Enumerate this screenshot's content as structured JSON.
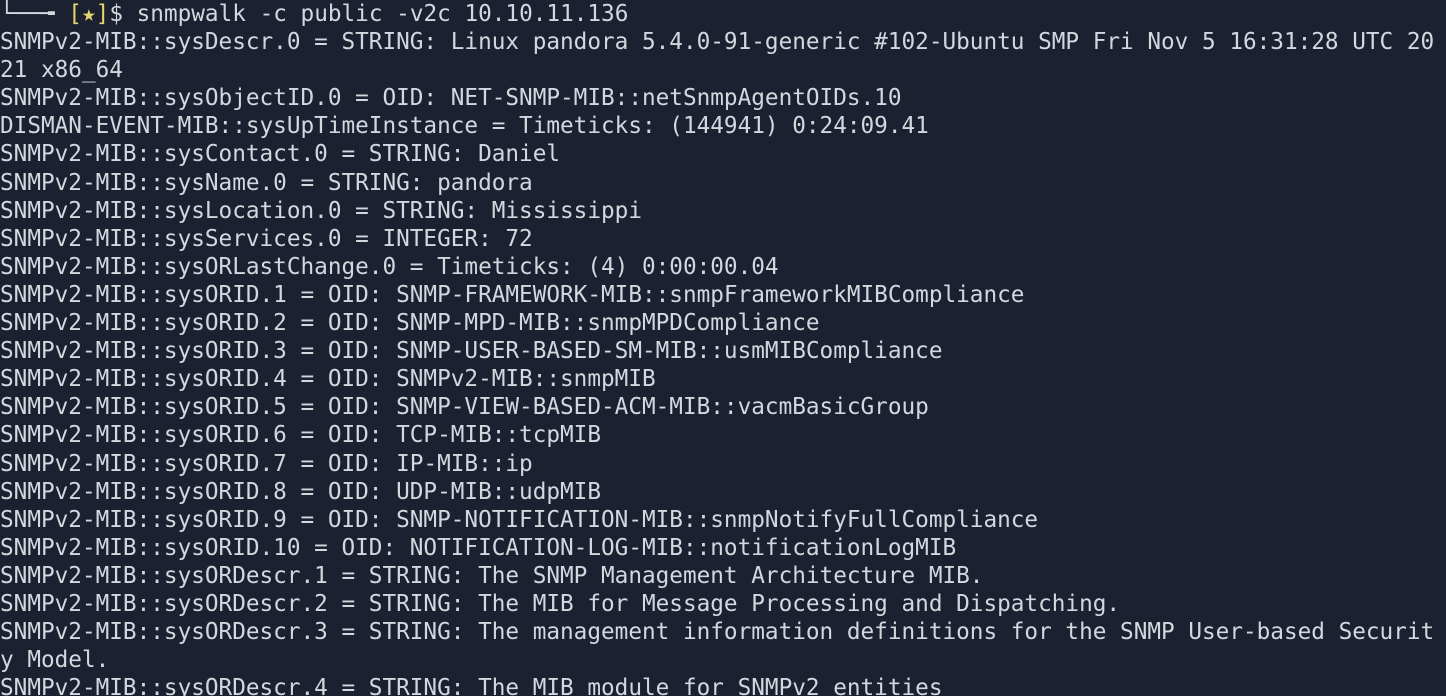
{
  "prompt": {
    "branch": "└──╼ ",
    "bracket_open": "[",
    "marker": "★",
    "bracket_close": "]",
    "symbol": "$ ",
    "command": "snmpwalk -c public -v2c 10.10.11.136"
  },
  "output_lines": [
    "SNMPv2-MIB::sysDescr.0 = STRING: Linux pandora 5.4.0-91-generic #102-Ubuntu SMP Fri Nov 5 16:31:28 UTC 20",
    "21 x86_64",
    "SNMPv2-MIB::sysObjectID.0 = OID: NET-SNMP-MIB::netSnmpAgentOIDs.10",
    "DISMAN-EVENT-MIB::sysUpTimeInstance = Timeticks: (144941) 0:24:09.41",
    "SNMPv2-MIB::sysContact.0 = STRING: Daniel",
    "SNMPv2-MIB::sysName.0 = STRING: pandora",
    "SNMPv2-MIB::sysLocation.0 = STRING: Mississippi",
    "SNMPv2-MIB::sysServices.0 = INTEGER: 72",
    "SNMPv2-MIB::sysORLastChange.0 = Timeticks: (4) 0:00:00.04",
    "SNMPv2-MIB::sysORID.1 = OID: SNMP-FRAMEWORK-MIB::snmpFrameworkMIBCompliance",
    "SNMPv2-MIB::sysORID.2 = OID: SNMP-MPD-MIB::snmpMPDCompliance",
    "SNMPv2-MIB::sysORID.3 = OID: SNMP-USER-BASED-SM-MIB::usmMIBCompliance",
    "SNMPv2-MIB::sysORID.4 = OID: SNMPv2-MIB::snmpMIB",
    "SNMPv2-MIB::sysORID.5 = OID: SNMP-VIEW-BASED-ACM-MIB::vacmBasicGroup",
    "SNMPv2-MIB::sysORID.6 = OID: TCP-MIB::tcpMIB",
    "SNMPv2-MIB::sysORID.7 = OID: IP-MIB::ip",
    "SNMPv2-MIB::sysORID.8 = OID: UDP-MIB::udpMIB",
    "SNMPv2-MIB::sysORID.9 = OID: SNMP-NOTIFICATION-MIB::snmpNotifyFullCompliance",
    "SNMPv2-MIB::sysORID.10 = OID: NOTIFICATION-LOG-MIB::notificationLogMIB",
    "SNMPv2-MIB::sysORDescr.1 = STRING: The SNMP Management Architecture MIB.",
    "SNMPv2-MIB::sysORDescr.2 = STRING: The MIB for Message Processing and Dispatching.",
    "SNMPv2-MIB::sysORDescr.3 = STRING: The management information definitions for the SNMP User-based Securit",
    "y Model.",
    "SNMPv2-MIB::sysORDescr.4 = STRING: The MIB module for SNMPv2 entities"
  ]
}
